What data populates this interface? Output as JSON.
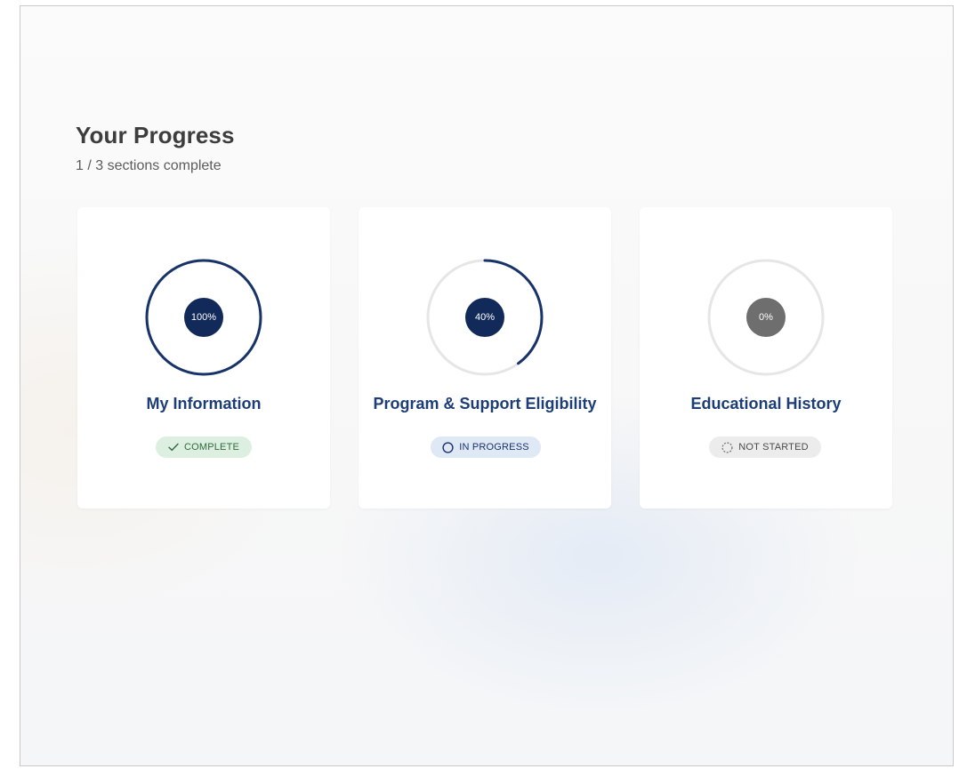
{
  "progress": {
    "title": "Your Progress",
    "summary": "1 / 3 sections complete"
  },
  "sections": [
    {
      "title": "My Information",
      "percent_label": "100%",
      "percent": 100,
      "status": "COMPLETE",
      "status_icon": "check-icon"
    },
    {
      "title": "Program & Support Eligibility",
      "percent_label": "40%",
      "percent": 40,
      "status": "IN PROGRESS",
      "status_icon": "circle-outline-icon"
    },
    {
      "title": "Educational History",
      "percent_label": "0%",
      "percent": 0,
      "status": "NOT STARTED",
      "status_icon": "dashed-circle-icon"
    }
  ],
  "colors": {
    "accent": "#1c3d75",
    "progress_ring": "#17336a",
    "ring_track": "#e6e6e6",
    "percent_dark": "#112a5a",
    "percent_grey": "#6e6e6e",
    "complete_bg": "#dcefe0",
    "complete_text": "#2f6b3c",
    "in_progress_bg": "#dfe8f5",
    "not_started_bg": "#ececec"
  }
}
